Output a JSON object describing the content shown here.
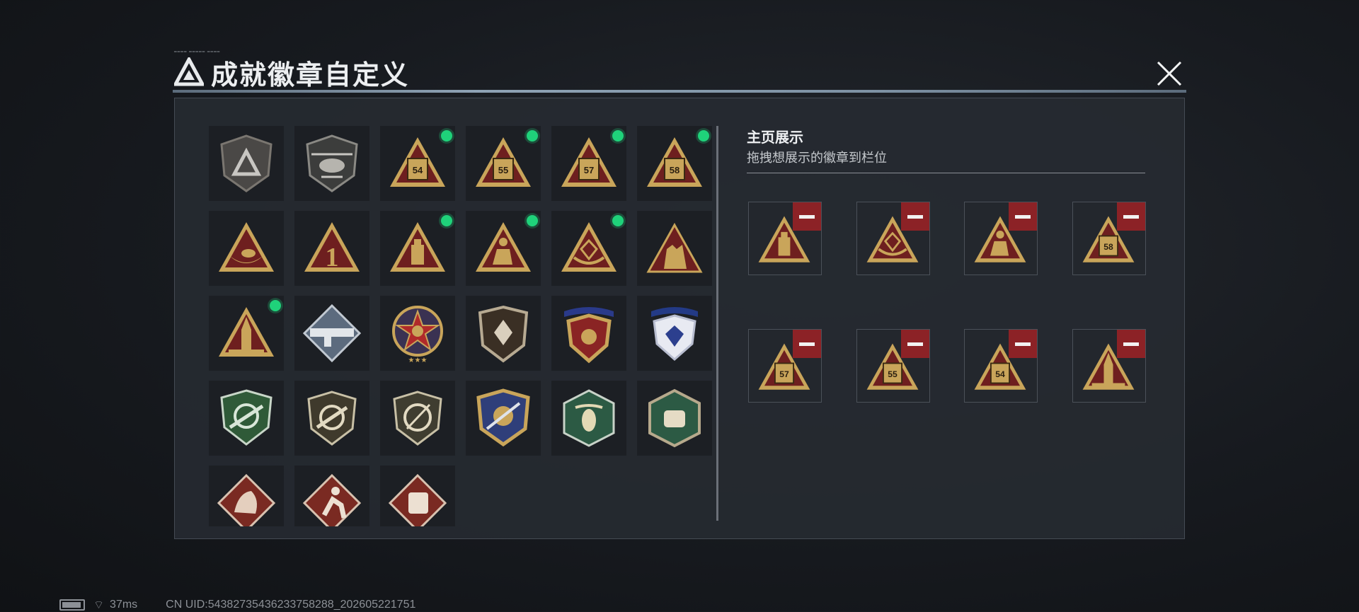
{
  "window": {
    "title": "成就徽章自定义",
    "deco_text": "━━━━ ━━━━━ ━━━━",
    "close_label": "✕"
  },
  "gallery": {
    "badges": [
      {
        "name": "logo-shield-badge",
        "selected": false
      },
      {
        "name": "helicopter-shield-badge",
        "selected": false
      },
      {
        "name": "s4-triangle-badge",
        "selected": true
      },
      {
        "name": "s5-triangle-badge",
        "selected": true
      },
      {
        "name": "s7-triangle-badge",
        "selected": true
      },
      {
        "name": "s8-triangle-badge",
        "selected": true
      },
      {
        "name": "boat-triangle-badge",
        "selected": false
      },
      {
        "name": "number-one-triangle-badge",
        "selected": false
      },
      {
        "name": "flashdrive-triangle-badge",
        "selected": true
      },
      {
        "name": "figure-triangle-badge",
        "selected": true
      },
      {
        "name": "diamond-hands-triangle-badge",
        "selected": true
      },
      {
        "name": "soldiers-triangle-badge",
        "selected": false
      },
      {
        "name": "rocket-triangle-badge",
        "selected": true
      },
      {
        "name": "rocket-launcher-diamond-badge",
        "selected": false
      },
      {
        "name": "star-medal-badge",
        "selected": false
      },
      {
        "name": "brown-shield-badge",
        "selected": false
      },
      {
        "name": "gold-shield-stars-badge",
        "selected": false
      },
      {
        "name": "blue-shield-diamond-badge",
        "selected": false
      },
      {
        "name": "green-rifle-scope-badge",
        "selected": false
      },
      {
        "name": "rifle-scope-badge",
        "selected": false
      },
      {
        "name": "knife-scope-badge",
        "selected": false
      },
      {
        "name": "blue-gold-crest-badge",
        "selected": false
      },
      {
        "name": "green-hexagon-bee-badge",
        "selected": false
      },
      {
        "name": "green-hexagon-fist-badge",
        "selected": false
      },
      {
        "name": "dragon-diamond-badge",
        "selected": false
      },
      {
        "name": "runner-diamond-badge",
        "selected": false
      },
      {
        "name": "fist-diamond-badge",
        "selected": false
      }
    ]
  },
  "showcase": {
    "title": "主页展示",
    "subtitle": "拖拽想展示的徽章到栏位",
    "slots": [
      {
        "badge": "flashdrive-triangle-badge",
        "label": ""
      },
      {
        "badge": "diamond-hands-triangle-badge",
        "label": ""
      },
      {
        "badge": "figure-triangle-badge",
        "label": ""
      },
      {
        "badge": "s8-triangle-badge",
        "label": "58"
      },
      {
        "badge": "s7-triangle-badge",
        "label": "57"
      },
      {
        "badge": "s5-triangle-badge",
        "label": "55"
      },
      {
        "badge": "s4-triangle-badge",
        "label": "54"
      },
      {
        "badge": "rocket-triangle-badge",
        "label": ""
      }
    ]
  },
  "gallery_labels": {
    "s4": "54",
    "s5": "55",
    "s7": "57",
    "s8": "58",
    "one": "1"
  },
  "footer": {
    "ping": "37ms",
    "uid": "CN UID:54382735436233758288_202605221751"
  },
  "colors": {
    "gold": "#c9a55a",
    "maroon": "#6e1f1f",
    "selected_dot": "#1fd27a",
    "remove_button": "#8c2226"
  }
}
